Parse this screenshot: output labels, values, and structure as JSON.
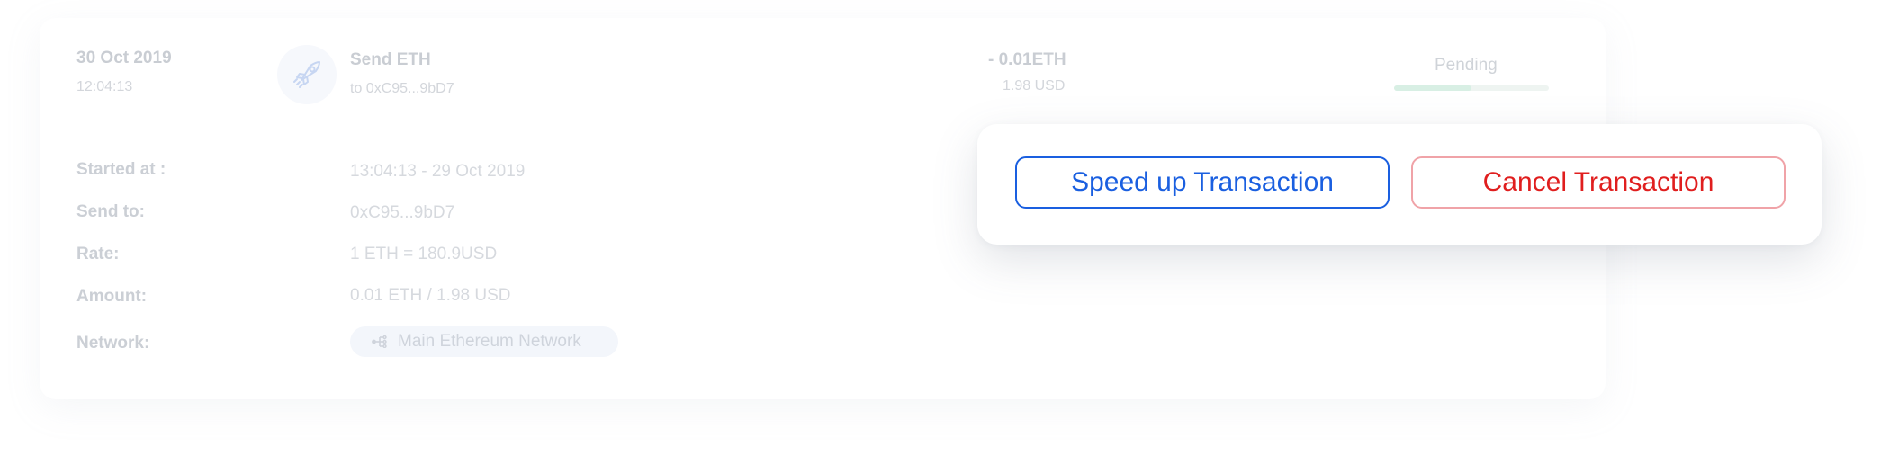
{
  "transaction": {
    "date": "30 Oct 2019",
    "time": "12:04:13",
    "title": "Send ETH",
    "to": "to 0xC95...9bD7",
    "amount": "- 0.01ETH",
    "amount_usd": "1.98 USD",
    "status": "Pending",
    "progress_fraction": 0.5,
    "icon": "rocket-icon"
  },
  "details": {
    "started_label": "Started at :",
    "started_value": "13:04:13 - 29 Oct 2019",
    "send_to_label": "Send to:",
    "send_to_value": "0xC95...9bD7",
    "rate_label": "Rate:",
    "rate_value": "1 ETH = 180.9USD",
    "amount_label": "Amount:",
    "amount_value": "0.01 ETH / 1.98 USD",
    "network_label": "Network:",
    "network_value": "Main Ethereum Network",
    "network_icon": "network-icon"
  },
  "actions": {
    "speed_up_label": "Speed up Transaction",
    "cancel_label": "Cancel Transaction"
  },
  "colors": {
    "speed_up": "#1a5fe0",
    "cancel_text": "#e01e1e",
    "cancel_border": "#f0a3a8"
  }
}
